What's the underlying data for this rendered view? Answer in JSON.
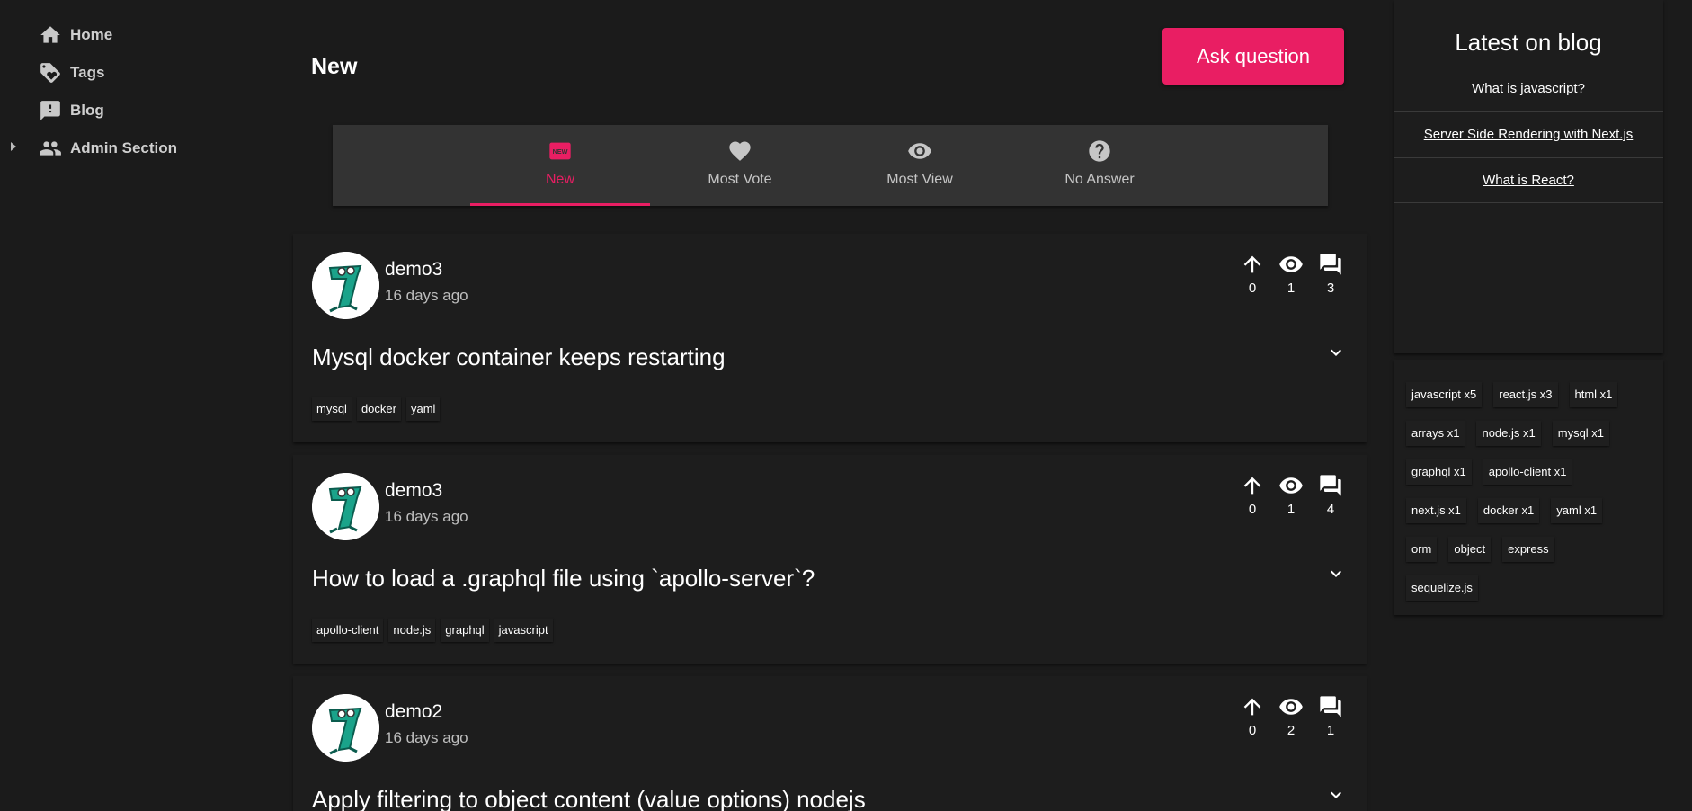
{
  "sidebar": {
    "items": [
      {
        "label": "Home",
        "icon": "home-icon"
      },
      {
        "label": "Tags",
        "icon": "tag-icon"
      },
      {
        "label": "Blog",
        "icon": "feedback-icon"
      },
      {
        "label": "Admin Section",
        "icon": "people-icon"
      }
    ]
  },
  "main": {
    "title": "New",
    "ask_button": "Ask question",
    "tabs": [
      {
        "label": "New",
        "icon": "new-badge-icon"
      },
      {
        "label": "Most Vote",
        "icon": "heart-icon"
      },
      {
        "label": "Most View",
        "icon": "eye-icon"
      },
      {
        "label": "No Answer",
        "icon": "help-circle-icon"
      }
    ],
    "questions": [
      {
        "author": "demo3",
        "time": "16 days ago",
        "votes": "0",
        "views": "1",
        "answers": "3",
        "title": "Mysql docker container keeps restarting",
        "tags": [
          "mysql",
          "docker",
          "yaml"
        ]
      },
      {
        "author": "demo3",
        "time": "16 days ago",
        "votes": "0",
        "views": "1",
        "answers": "4",
        "title": "How to load a .graphql file using `apollo-server`?",
        "tags": [
          "apollo-client",
          "node.js",
          "graphql",
          "javascript"
        ]
      },
      {
        "author": "demo2",
        "time": "16 days ago",
        "votes": "0",
        "views": "2",
        "answers": "1",
        "title": "Apply filtering to object content (value options) nodejs",
        "tags": []
      }
    ]
  },
  "blog": {
    "title": "Latest on blog",
    "links": [
      "What is javascript?",
      "Server Side Rendering with Next.js",
      "What is React?"
    ]
  },
  "tags": {
    "rows": [
      [
        "javascript x5",
        "react.js x3",
        "html x1"
      ],
      [
        "arrays x1",
        "node.js x1",
        "mysql x1"
      ],
      [
        "graphql x1",
        "apollo-client x1"
      ],
      [
        "next.js x1",
        "docker x1",
        "yaml x1"
      ],
      [
        "orm",
        "object",
        "express"
      ],
      [
        "sequelize.js"
      ]
    ]
  },
  "colors": {
    "accent": "#e91e63",
    "background": "#1b1b1b",
    "card": "#1d1d1d",
    "tabs_bg": "#333333"
  }
}
